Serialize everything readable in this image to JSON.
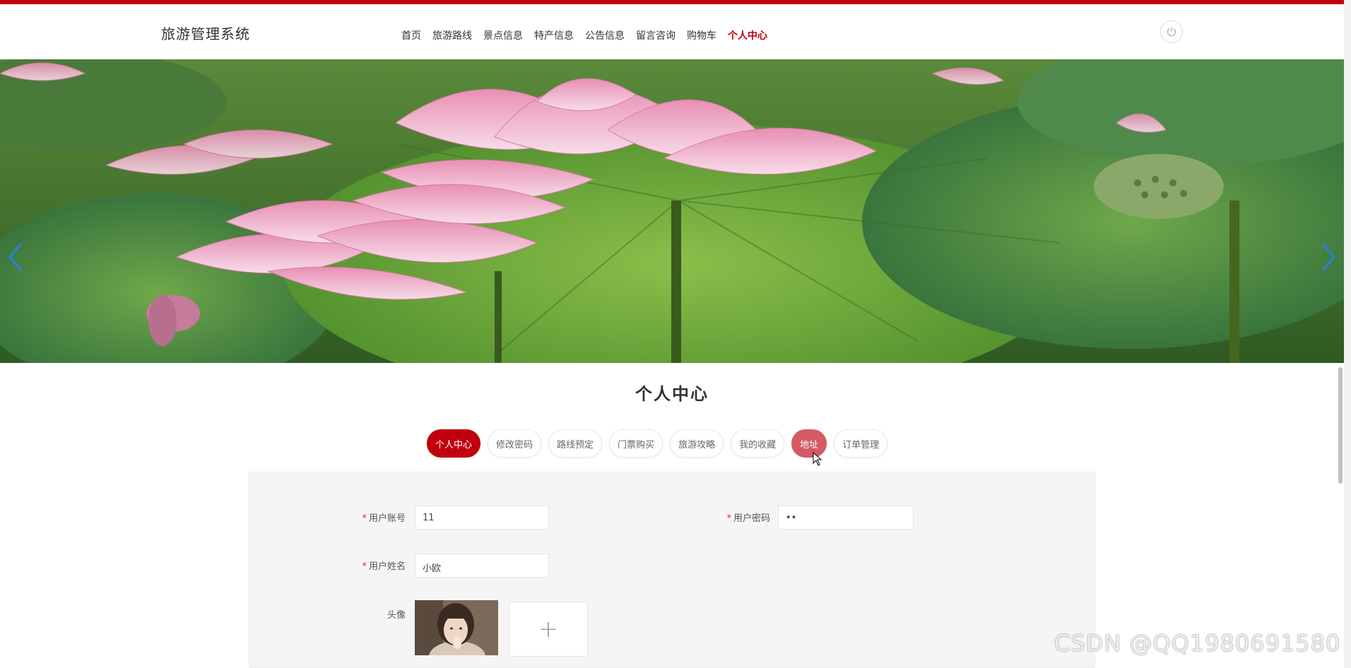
{
  "app": {
    "title": "旅游管理系统",
    "accent_color": "#c0000c"
  },
  "nav": {
    "items": [
      {
        "label": "首页"
      },
      {
        "label": "旅游路线"
      },
      {
        "label": "景点信息"
      },
      {
        "label": "特产信息"
      },
      {
        "label": "公告信息"
      },
      {
        "label": "留言咨询"
      },
      {
        "label": "购物车"
      },
      {
        "label": "个人中心",
        "active": true
      }
    ],
    "power_icon": "power-icon"
  },
  "banner": {
    "image": "lotus-flowers-photo",
    "prev_icon": "chevron-left-icon",
    "next_icon": "chevron-right-icon"
  },
  "page": {
    "title": "个人中心"
  },
  "tabs": [
    {
      "label": "个人中心",
      "state": "active"
    },
    {
      "label": "修改密码"
    },
    {
      "label": "路线预定"
    },
    {
      "label": "门票购买"
    },
    {
      "label": "旅游攻略"
    },
    {
      "label": "我的收藏"
    },
    {
      "label": "地址",
      "state": "hover"
    },
    {
      "label": "订单管理"
    }
  ],
  "form": {
    "account": {
      "required_mark": "*",
      "label": "用户账号",
      "value": "11"
    },
    "password": {
      "required_mark": "*",
      "label": "用户密码",
      "value": "••"
    },
    "name": {
      "required_mark": "*",
      "label": "用户姓名",
      "value": "小欧"
    },
    "avatar": {
      "label": "头像",
      "upload_icon": "plus-icon",
      "upload_symbol": "+"
    }
  },
  "watermark": "CSDN @QQ1980691580"
}
